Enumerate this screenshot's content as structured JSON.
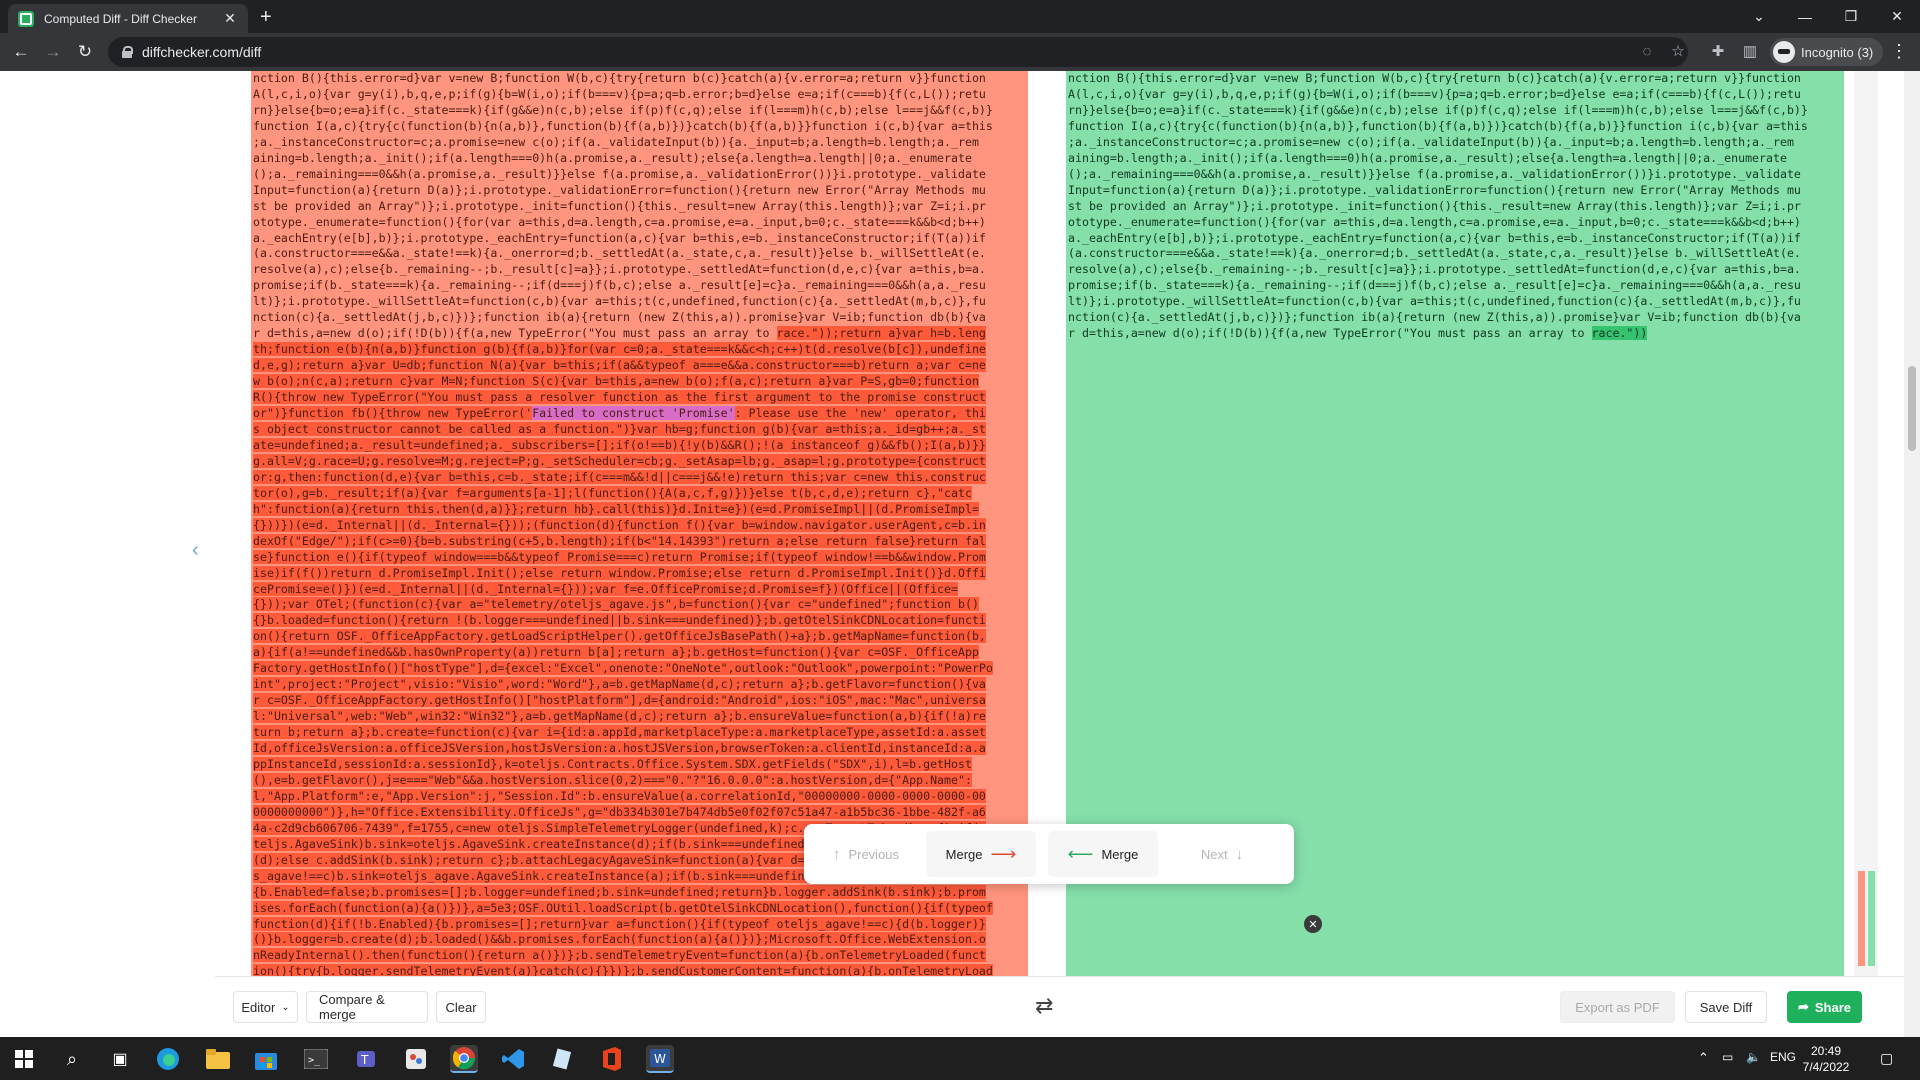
{
  "browser": {
    "tab_title": "Computed Diff - Diff Checker",
    "tab_close": "✕",
    "new_tab": "+",
    "url": "diffchecker.com/diff",
    "profile_label": "Incognito (3)"
  },
  "diff": {
    "left_lines": [
      [
        [
          "nction B(){this.error=d}var v=new B;function W(b,c){try{return b(c)}catch(a){v.error=a;return v}}function",
          ""
        ]
      ],
      [
        [
          "A(l,c,i,o){var g=y(i),b,q,e,p;if(g){b=W(i,o);if(b===v){p=a;q=b.error;b=d}else e=a;if(c===b){f(c,L());retu",
          ""
        ]
      ],
      [
        [
          "rn}}else{b=o;e=a}if(c._state===k){if(g&&e)n(c,b);else if(p)f(c,q);else if(l===m)h(c,b);else l===j&&f(c,b)}",
          ""
        ]
      ],
      [
        [
          "function I(a,c){try{c(function(b){n(a,b)},function(b){f(a,b)})}catch(b){f(a,b)}}function i(c,b){var a=this",
          ""
        ]
      ],
      [
        [
          ";a._instanceConstructor=c;a.promise=new c(o);if(a._validateInput(b)){a._input=b;a.length=b.length;a._rem",
          ""
        ]
      ],
      [
        [
          "aining=b.length;a._init();if(a.length===0)h(a.promise,a._result);else{a.length=a.length||0;a._enumerate",
          ""
        ]
      ],
      [
        [
          "();a._remaining===0&&h(a.promise,a._result)}}else f(a.promise,a._validationError())}i.prototype._validate",
          ""
        ]
      ],
      [
        [
          "Input=function(a){return D(a)};i.prototype._validationError=function(){return new Error(\"Array Methods mu",
          ""
        ]
      ],
      [
        [
          "st be provided an Array\")};i.prototype._init=function(){this._result=new Array(this.length)};var Z=i;i.pr",
          ""
        ]
      ],
      [
        [
          "ototype._enumerate=function(){for(var a=this,d=a.length,c=a.promise,e=a._input,b=0;c._state===k&&b<d;b++)",
          ""
        ]
      ],
      [
        [
          "a._eachEntry(e[b],b)};i.prototype._eachEntry=function(a,c){var b=this,e=b._instanceConstructor;if(T(a))if",
          ""
        ]
      ],
      [
        [
          "(a.constructor===e&&a._state!==k){a._onerror=d;b._settledAt(a._state,c,a._result)}else b._willSettleAt(e.",
          ""
        ]
      ],
      [
        [
          "resolve(a),c);else{b._remaining--;b._result[c]=a}};i.prototype._settledAt=function(d,e,c){var a=this,b=a.",
          ""
        ]
      ],
      [
        [
          "promise;if(b._state===k){a._remaining--;if(d===j)f(b,c);else a._result[e]=c}a._remaining===0&&h(a,a._resu",
          ""
        ]
      ],
      [
        [
          "lt)};i.prototype._willSettleAt=function(c,b){var a=this;t(c,undefined,function(c){a._settledAt(m,b,c)},fu",
          ""
        ]
      ],
      [
        [
          "nction(c){a._settledAt(j,b,c)})};function ib(a){return (new Z(this,a)).promise}var V=ib;function db(b){va",
          ""
        ]
      ],
      [
        [
          "r d=this,a=new d(o);if(!D(b)){f(a,new TypeError(\"You must pass an array to ",
          ""
        ],
        [
          "race.\"));return a}var h=b.leng",
          "del"
        ]
      ],
      [
        [
          "th;function e(b){n(a,b)}function g(b){f(a,b)}for(var c=0;a._state===k&&c<h;c++)t(d.resolve(b[c]),undefine",
          "del"
        ]
      ],
      [
        [
          "d,e,g);return a}var U=db;function N(a){var b=this;if(a&&typeof a===e&&a.constructor===b)return a;var c=ne",
          "del"
        ]
      ],
      [
        [
          "w b(o);n(c,a);return c}var M=N;function S(c){var b=this,a=new b(o);f(a,c);return a}var P=S,gb=0;function",
          "del"
        ]
      ],
      [
        [
          "R(){throw new TypeError(\"You must pass a resolver function as the first argument to the promise construct",
          "del"
        ]
      ],
      [
        [
          "or\")}function fb(){throw new TypeError('",
          "del"
        ],
        [
          "Failed to construct 'Promise'",
          "hl"
        ],
        [
          ": Please use the 'new' operator, thi",
          "del"
        ]
      ],
      [
        [
          "s object constructor cannot be called as a function.\")}var hb=g;function g(b){var a=this;a._id=gb++;a._st",
          "del"
        ]
      ],
      [
        [
          "ate=undefined;a._result=undefined;a._subscribers=[];if(o!==b){!y(b)&&R();!(a instanceof g)&&fb();I(a,b)}}",
          "del"
        ]
      ],
      [
        [
          "g.all=V;g.race=U;g.resolve=M;g.reject=P;g._setScheduler=cb;g._setAsap=lb;g._asap=l;g.prototype={construct",
          "del"
        ]
      ],
      [
        [
          "or:g,then:function(d,e){var b=this,c=b._state;if(c===m&&!d||c===j&&!e)return this;var c=new this.construc",
          "del"
        ]
      ],
      [
        [
          "tor(o),g=b._result;if(a){var f=arguments[a-1];l(function(){A(a,c,f,g)})}else t(b,c,d,e);return c},\"catc",
          "del"
        ]
      ],
      [
        [
          "h\":function(a){return this.then(d,a)}};return hb}.call(this)}d.Init=e})(e=d.PromiseImpl||(d.PromiseImpl=",
          "del"
        ]
      ],
      [
        [
          "{}))})(e=d._Internal||(d._Internal={}));(function(d){function f(){var b=window.navigator.userAgent,c=b.in",
          "del"
        ]
      ],
      [
        [
          "dexOf(\"Edge/\");if(c>=0){b=b.substring(c+5,b.length);if(b<\"14.14393\")return a;else return false}return fal",
          "del"
        ]
      ],
      [
        [
          "se}function e(){if(typeof window===b&&typeof Promise===c)return Promise;if(typeof window!==b&&window.Prom",
          "del"
        ]
      ],
      [
        [
          "ise)if(f())return d.PromiseImpl.Init();else return window.Promise;else return d.PromiseImpl.Init()}d.Offi",
          "del"
        ]
      ],
      [
        [
          "cePromise=e()})(e=d._Internal||(d._Internal={}));var f=e.OfficePromise;d.Promise=f})(Office||(Office=",
          "del"
        ]
      ],
      [
        [
          "{}));var OTel;(function(c){var a=\"telemetry/oteljs_agave.js\",b=function(){var c=\"undefined\";function b()",
          "del"
        ]
      ],
      [
        [
          "{}b.loaded=function(){return !(b.logger===undefined||b.sink===undefined)};b.getOtelSinkCDNLocation=functi",
          "del"
        ]
      ],
      [
        [
          "on(){return OSF._OfficeAppFactory.getLoadScriptHelper().getOfficeJsBasePath()+a};b.getMapName=function(b,",
          "del"
        ]
      ],
      [
        [
          "a){if(a!==undefined&&b.hasOwnProperty(a))return b[a];return a};b.getHost=function(){var c=OSF._OfficeApp",
          "del"
        ]
      ],
      [
        [
          "Factory.getHostInfo()[\"hostType\"],d={excel:\"Excel\",onenote:\"OneNote\",outlook:\"Outlook\",powerpoint:\"PowerPo",
          "del"
        ]
      ],
      [
        [
          "int\",project:\"Project\",visio:\"Visio\",word:\"Word\"},a=b.getMapName(d,c);return a};b.getFlavor=function(){va",
          "del"
        ]
      ],
      [
        [
          "r c=OSF._OfficeAppFactory.getHostInfo()[\"hostPlatform\"],d={android:\"Android\",ios:\"iOS\",mac:\"Mac\",universa",
          "del"
        ]
      ],
      [
        [
          "l:\"Universal\",web:\"Web\",win32:\"Win32\"},a=b.getMapName(d,c);return a};b.ensureValue=function(a,b){if(!a)re",
          "del"
        ]
      ],
      [
        [
          "turn b;return a};b.create=function(c){var i={id:a.appId,marketplaceType:a.marketplaceType,assetId:a.asset",
          "del"
        ]
      ],
      [
        [
          "Id,officeJsVersion:a.officeJSVersion,hostJsVersion:a.hostJSVersion,browserToken:a.clientId,instanceId:a.a",
          "del"
        ]
      ],
      [
        [
          "ppInstanceId,sessionId:a.sessionId},k=oteljs.Contracts.Office.System.SDX.getFields(\"SDX\",i),l=b.getHost",
          "del"
        ]
      ],
      [
        [
          "(),e=b.getFlavor(),j=e===\"Web\"&&a.hostVersion.slice(0,2)===\"0.\"?\"16.0.0.0\":a.hostVersion,d={\"App.Name\":",
          "del"
        ]
      ],
      [
        [
          "l,\"App.Platform\":e,\"App.Version\":j,\"Session.Id\":b.ensureValue(a.correlationId,\"00000000-0000-0000-0000-00",
          "del"
        ]
      ],
      [
        [
          "0000000000\")},h=\"Office.Extensibility.OfficeJs\",g=\"db334b301e7b474db5e0f02f07c51a47-a1b5bc36-1bbe-482f-a6",
          "del"
        ]
      ],
      [
        [
          "4a-c2d9cb606706-7439\",f=1755,c=new oteljs.SimpleTelemetryLogger(undefined,k);c.setTenantToken(h,g,f);if(o",
          "del"
        ]
      ],
      [
        [
          "teljs.AgaveSink)b.sink=oteljs.AgaveSink.createInstance(d);if(b.sink===undefined)b.attachLegacyAgaveSink",
          "del"
        ]
      ],
      [
        [
          "(d);else c.addSink(b.sink);return c};b.attachLegacyAgaveSink=function(a){var d=function(){if(typeof oteljs",
          "del"
        ]
      ],
      [
        [
          "s_agave!==c)b.sink=oteljs_agave.AgaveSink.createInstance(a);if(b.sink===undefined||b.logger===undefined)",
          "del"
        ]
      ],
      [
        [
          "{b.Enabled=false;b.promises=[];b.logger=undefined;b.sink=undefined;return}b.logger.addSink(b.sink);b.prom",
          "del"
        ]
      ],
      [
        [
          "ises.forEach(function(a){a()})},a=5e3;OSF.OUtil.loadScript(b.getOtelSinkCDNLocation(),function(){if(typeof",
          "del"
        ]
      ],
      [
        [
          "function(d){if(!b.Enabled){b.promises=[];return}var a=function(){if(typeof oteljs_agave!==c){d(b.logger)}",
          "del"
        ]
      ],
      [
        [
          "()}b.logger=b.create(d);b.loaded()&&b.promises.forEach(function(a){a()})};Microsoft.Office.WebExtension.o",
          "del"
        ]
      ],
      [
        [
          "nReadyInternal().then(function(){return a()})};b.sendTelemetryEvent=function(a){b.onTelemetryLoaded(funct",
          "del"
        ]
      ],
      [
        [
          "ion(){try{b.logger.sendTelemetryEvent(a)}catch(c){}})};b.sendCustomerContent=function(a){b.onTelemetryLoad",
          "del"
        ]
      ]
    ],
    "right_lines": [
      [
        [
          "nction B(){this.error=d}var v=new B;function W(b,c){try{return b(c)}catch(a){v.error=a;return v}}function",
          ""
        ]
      ],
      [
        [
          "A(l,c,i,o){var g=y(i),b,q,e,p;if(g){b=W(i,o);if(b===v){p=a;q=b.error;b=d}else e=a;if(c===b){f(c,L());retu",
          ""
        ]
      ],
      [
        [
          "rn}}else{b=o;e=a}if(c._state===k){if(g&&e)n(c,b);else if(p)f(c,q);else if(l===m)h(c,b);else l===j&&f(c,b)}",
          ""
        ]
      ],
      [
        [
          "function I(a,c){try{c(function(b){n(a,b)},function(b){f(a,b)})}catch(b){f(a,b)}}function i(c,b){var a=this",
          ""
        ]
      ],
      [
        [
          ";a._instanceConstructor=c;a.promise=new c(o);if(a._validateInput(b)){a._input=b;a.length=b.length;a._rem",
          ""
        ]
      ],
      [
        [
          "aining=b.length;a._init();if(a.length===0)h(a.promise,a._result);else{a.length=a.length||0;a._enumerate",
          ""
        ]
      ],
      [
        [
          "();a._remaining===0&&h(a.promise,a._result)}}else f(a.promise,a._validationError())}i.prototype._validate",
          ""
        ]
      ],
      [
        [
          "Input=function(a){return D(a)};i.prototype._validationError=function(){return new Error(\"Array Methods mu",
          ""
        ]
      ],
      [
        [
          "st be provided an Array\")};i.prototype._init=function(){this._result=new Array(this.length)};var Z=i;i.pr",
          ""
        ]
      ],
      [
        [
          "ototype._enumerate=function(){for(var a=this,d=a.length,c=a.promise,e=a._input,b=0;c._state===k&&b<d;b++)",
          ""
        ]
      ],
      [
        [
          "a._eachEntry(e[b],b)};i.prototype._eachEntry=function(a,c){var b=this,e=b._instanceConstructor;if(T(a))if",
          ""
        ]
      ],
      [
        [
          "(a.constructor===e&&a._state!==k){a._onerror=d;b._settledAt(a._state,c,a._result)}else b._willSettleAt(e.",
          ""
        ]
      ],
      [
        [
          "resolve(a),c);else{b._remaining--;b._result[c]=a}};i.prototype._settledAt=function(d,e,c){var a=this,b=a.",
          ""
        ]
      ],
      [
        [
          "promise;if(b._state===k){a._remaining--;if(d===j)f(b,c);else a._result[e]=c}a._remaining===0&&h(a,a._resu",
          ""
        ]
      ],
      [
        [
          "lt)};i.prototype._willSettleAt=function(c,b){var a=this;t(c,undefined,function(c){a._settledAt(m,b,c)},fu",
          ""
        ]
      ],
      [
        [
          "nction(c){a._settledAt(j,b,c)})};function ib(a){return (new Z(this,a)).promise}var V=ib;function db(b){va",
          ""
        ]
      ],
      [
        [
          "r d=this,a=new d(o);if(!D(b)){f(a,new TypeError(\"You must pass an array to ",
          ""
        ],
        [
          "race.\"))",
          "add"
        ]
      ]
    ]
  },
  "merge_popup": {
    "previous": "Previous",
    "merge_right": "Merge",
    "merge_left": "Merge",
    "next": "Next"
  },
  "bottom_bar": {
    "editor": "Editor",
    "compare_merge": "Compare & merge",
    "clear": "Clear",
    "export_pdf": "Export as PDF",
    "save_diff": "Save Diff",
    "share": "Share"
  },
  "taskbar": {
    "lang": "ENG",
    "time": "20:49",
    "date": "7/4/2022"
  },
  "colors": {
    "left_pane": "#ff957e",
    "left_changed": "#ff5a3a",
    "left_highlight": "#d96cc6",
    "right_pane": "#84dfa9",
    "right_changed": "#35c370",
    "share_button": "#1eb05b"
  }
}
